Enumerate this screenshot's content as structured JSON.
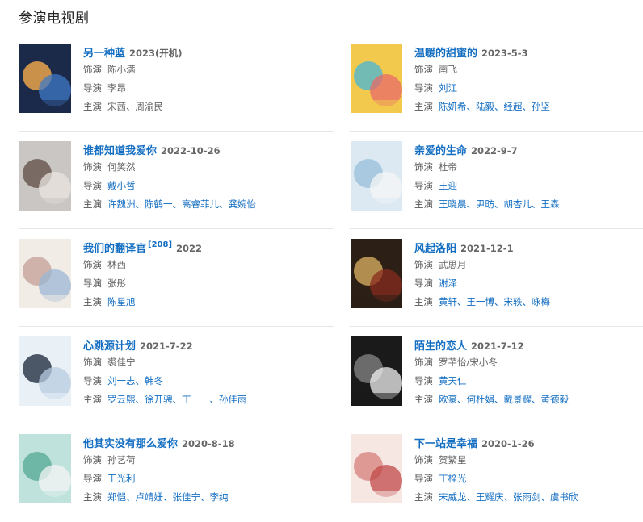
{
  "section_title": "参演电视剧",
  "labels": {
    "role": "饰演",
    "director": "导演",
    "cast": "主演"
  },
  "items": [
    {
      "title": "另一种蓝",
      "sup": "",
      "date": "2023(开机)",
      "role": "陈小满",
      "role_link": false,
      "director": [
        "李昂"
      ],
      "director_link": false,
      "cast": [
        "宋茜",
        "周渝民"
      ],
      "cast_link": false,
      "poster_colors": [
        "#1c2a4a",
        "#e8a34a",
        "#3d7ac7"
      ]
    },
    {
      "title": "温暖的甜蜜的",
      "sup": "",
      "date": "2023-5-3",
      "role": "南飞",
      "role_link": false,
      "director": [
        "刘江"
      ],
      "director_link": true,
      "cast": [
        "陈妍希",
        "陆毅",
        "经超",
        "孙坚"
      ],
      "cast_link": true,
      "poster_colors": [
        "#f2c94c",
        "#5ab9c7",
        "#e86a6a"
      ]
    },
    {
      "title": "谁都知道我爱你",
      "sup": "",
      "date": "2022-10-26",
      "role": "何笑然",
      "role_link": false,
      "director": [
        "戴小哲"
      ],
      "director_link": true,
      "cast": [
        "许魏洲",
        "陈鹤一",
        "高睿菲儿",
        "龚婉怡"
      ],
      "cast_link": true,
      "poster_colors": [
        "#c9c6c3",
        "#6b5a52",
        "#e9e4df"
      ]
    },
    {
      "title": "亲爱的生命",
      "sup": "",
      "date": "2022-9-7",
      "role": "杜帝",
      "role_link": false,
      "director": [
        "王迎"
      ],
      "director_link": true,
      "cast": [
        "王晓晨",
        "尹昉",
        "胡杏儿",
        "王森"
      ],
      "cast_link": true,
      "poster_colors": [
        "#dce9f2",
        "#9fc3dc",
        "#f6f6f6"
      ]
    },
    {
      "title": "我们的翻译官",
      "sup": "[208]",
      "date": "2022",
      "role": "林西",
      "role_link": false,
      "director": [
        "张彤"
      ],
      "director_link": false,
      "cast": [
        "陈星旭"
      ],
      "cast_link": true,
      "poster_colors": [
        "#f1ece6",
        "#c9a9a0",
        "#9bb7d4"
      ]
    },
    {
      "title": "风起洛阳",
      "sup": "",
      "date": "2021-12-1",
      "role": "武思月",
      "role_link": false,
      "director": [
        "谢泽"
      ],
      "director_link": true,
      "cast": [
        "黄轩",
        "王一博",
        "宋轶",
        "咏梅"
      ],
      "cast_link": true,
      "poster_colors": [
        "#2b1f16",
        "#c9a15a",
        "#8a2c1f"
      ]
    },
    {
      "title": "心跳源计划",
      "sup": "",
      "date": "2021-7-22",
      "role": "裘佳宁",
      "role_link": false,
      "director": [
        "刘一志",
        "韩冬"
      ],
      "director_link": true,
      "cast": [
        "罗云熙",
        "徐开骋",
        "丁一一",
        "孙佳雨"
      ],
      "cast_link": true,
      "poster_colors": [
        "#e9f1f7",
        "#2f3b4c",
        "#b7cbe0"
      ]
    },
    {
      "title": "陌生的恋人",
      "sup": "",
      "date": "2021-7-12",
      "role": "罗芊怡/宋小冬",
      "role_link": false,
      "director": [
        "黄天仁"
      ],
      "director_link": true,
      "cast": [
        "欧豪",
        "何杜娟",
        "戴景耀",
        "黄德毅"
      ],
      "cast_link": true,
      "poster_colors": [
        "#1a1a1a",
        "#7a7a7a",
        "#f0f0f0"
      ]
    },
    {
      "title": "他其实没有那么爱你",
      "sup": "",
      "date": "2020-8-18",
      "role": "孙艺荷",
      "role_link": false,
      "director": [
        "王光利"
      ],
      "director_link": true,
      "cast": [
        "郑恺",
        "卢靖姗",
        "张佳宁",
        "李纯"
      ],
      "cast_link": true,
      "poster_colors": [
        "#bfe3dc",
        "#5fae9c",
        "#f4f4f4"
      ]
    },
    {
      "title": "下一站是幸福",
      "sup": "",
      "date": "2020-1-26",
      "role": "贺繁星",
      "role_link": false,
      "director": [
        "丁梓光"
      ],
      "director_link": true,
      "cast": [
        "宋威龙",
        "王耀庆",
        "张雨剑",
        "虞书欣"
      ],
      "cast_link": true,
      "poster_colors": [
        "#f6e7e3",
        "#d98b86",
        "#c24a4a"
      ]
    }
  ]
}
